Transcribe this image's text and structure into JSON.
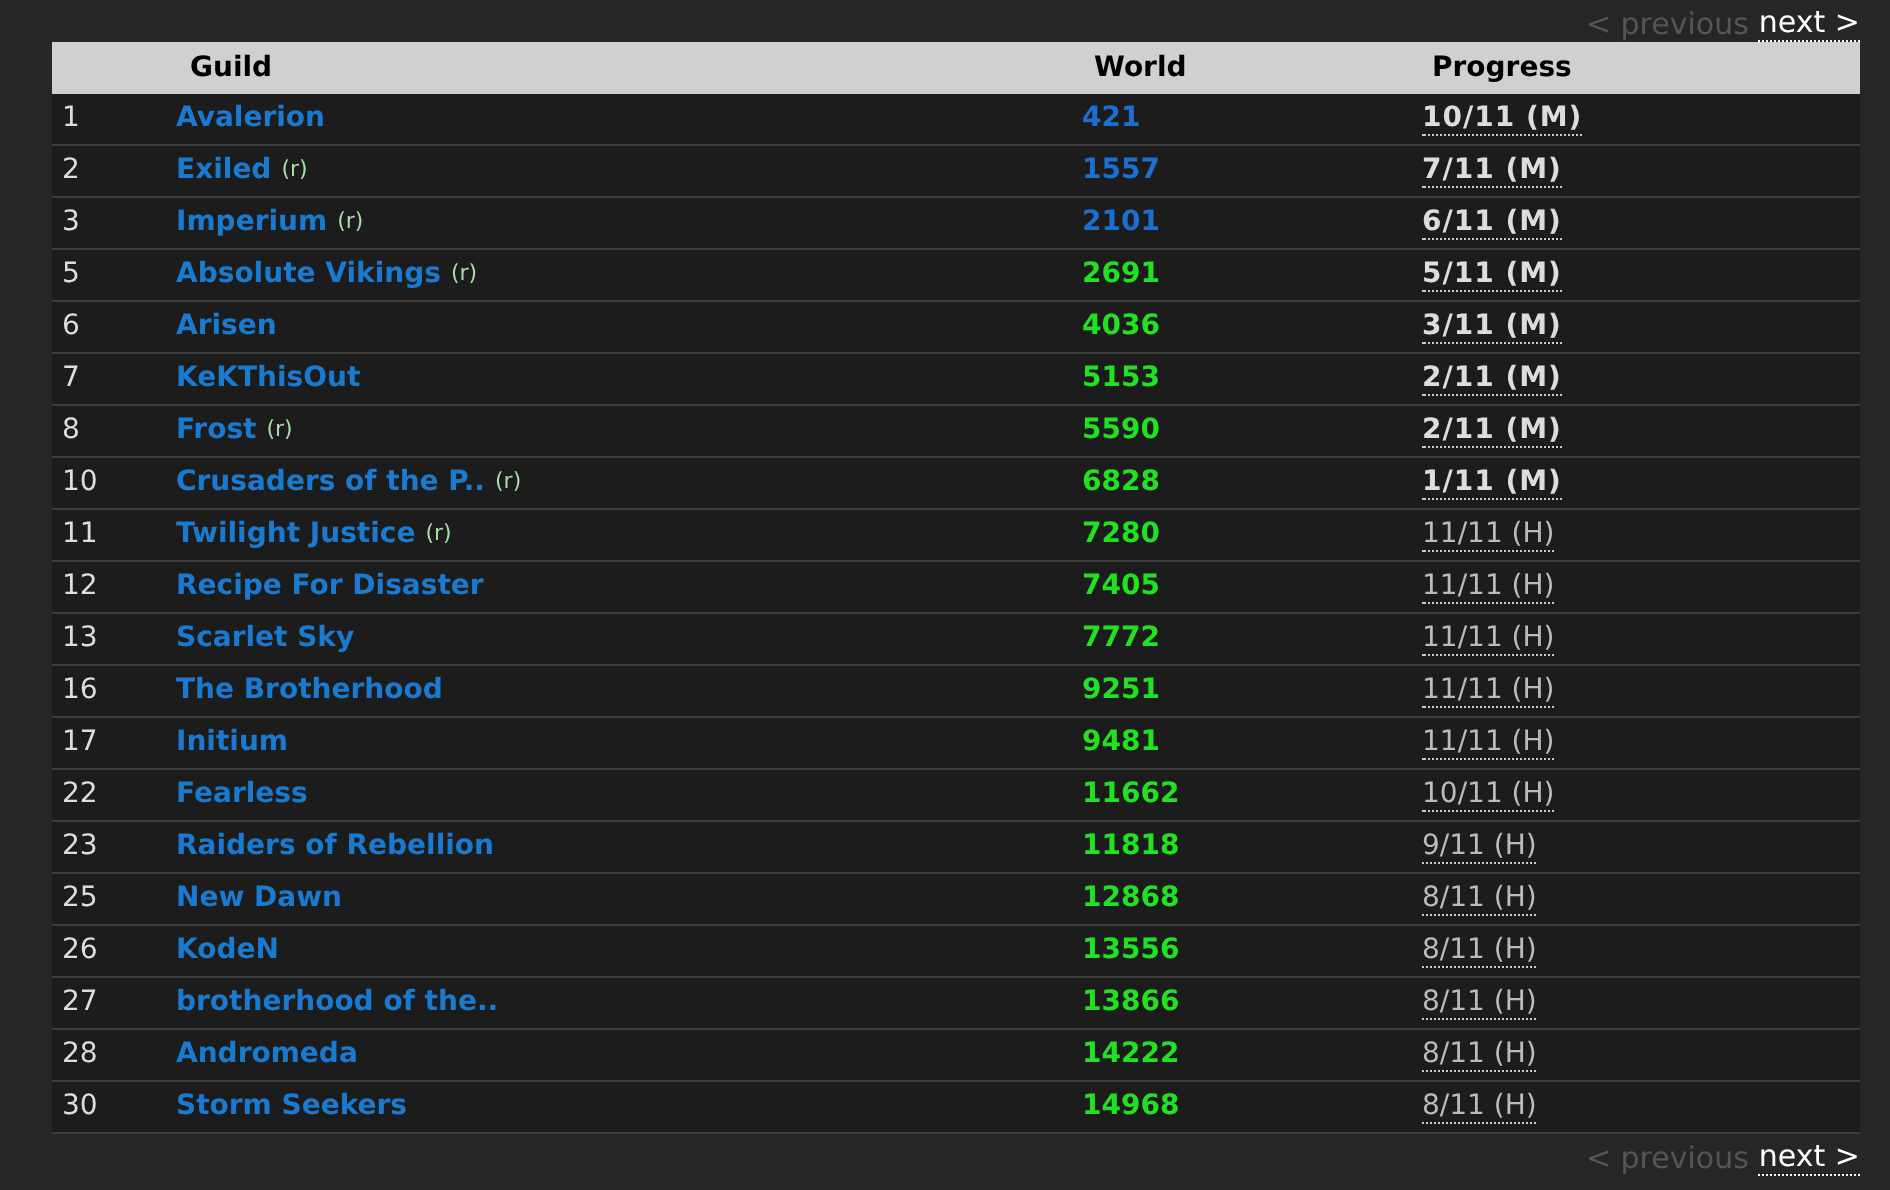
{
  "pager_top": {
    "previous": {
      "label": "< previous",
      "disabled": true
    },
    "next": {
      "label": "next >",
      "disabled": false
    }
  },
  "table": {
    "columns": [
      "Guild",
      "World",
      "Progress"
    ],
    "rows": [
      {
        "rank": "1",
        "guild": {
          "name": "Avalerion"
        },
        "world": "421",
        "color": "#1a6fd0",
        "progress": "10/11 (M)",
        "kind": "mythic"
      },
      {
        "rank": "2",
        "guild": {
          "name": "Exiled",
          "tag": "(r)"
        },
        "world": "1557",
        "color": "#1a6fd0",
        "progress": "7/11 (M)",
        "kind": "mythic"
      },
      {
        "rank": "3",
        "guild": {
          "name": "Imperium",
          "tag": "(r)"
        },
        "world": "2101",
        "color": "#1a6fd0",
        "progress": "6/11 (M)",
        "kind": "mythic"
      },
      {
        "rank": "5",
        "guild": {
          "name": "Absolute Vikings",
          "tag": "(r)"
        },
        "world": "2691",
        "color": "#22e022",
        "progress": "5/11 (M)",
        "kind": "mythic"
      },
      {
        "rank": "6",
        "guild": {
          "name": "Arisen"
        },
        "world": "4036",
        "color": "#22e022",
        "progress": "3/11 (M)",
        "kind": "mythic"
      },
      {
        "rank": "7",
        "guild": {
          "name": "KeKThisOut"
        },
        "world": "5153",
        "color": "#22e022",
        "progress": "2/11 (M)",
        "kind": "mythic"
      },
      {
        "rank": "8",
        "guild": {
          "name": "Frost",
          "tag": "(r)"
        },
        "world": "5590",
        "color": "#22e022",
        "progress": "2/11 (M)",
        "kind": "mythic"
      },
      {
        "rank": "10",
        "guild": {
          "name": "Crusaders of the P..",
          "tag": "(r)"
        },
        "world": "6828",
        "color": "#22e022",
        "progress": "1/11 (M)",
        "kind": "mythic"
      },
      {
        "rank": "11",
        "guild": {
          "name": "Twilight Justice",
          "tag": "(r)"
        },
        "world": "7280",
        "color": "#22e022",
        "progress": "11/11 (H)",
        "kind": "heroic"
      },
      {
        "rank": "12",
        "guild": {
          "name": "Recipe For Disaster"
        },
        "world": "7405",
        "color": "#22e022",
        "progress": "11/11 (H)",
        "kind": "heroic"
      },
      {
        "rank": "13",
        "guild": {
          "name": "Scarlet Sky"
        },
        "world": "7772",
        "color": "#22e022",
        "progress": "11/11 (H)",
        "kind": "heroic"
      },
      {
        "rank": "16",
        "guild": {
          "name": "The Brotherhood"
        },
        "world": "9251",
        "color": "#22e022",
        "progress": "11/11 (H)",
        "kind": "heroic"
      },
      {
        "rank": "17",
        "guild": {
          "name": "Initium"
        },
        "world": "9481",
        "color": "#22e022",
        "progress": "11/11 (H)",
        "kind": "heroic"
      },
      {
        "rank": "22",
        "guild": {
          "name": "Fearless"
        },
        "world": "11662",
        "color": "#22e022",
        "progress": "10/11 (H)",
        "kind": "heroic"
      },
      {
        "rank": "23",
        "guild": {
          "name": "Raiders of Rebellion"
        },
        "world": "11818",
        "color": "#22e022",
        "progress": "9/11 (H)",
        "kind": "heroic"
      },
      {
        "rank": "25",
        "guild": {
          "name": "New Dawn"
        },
        "world": "12868",
        "color": "#22e022",
        "progress": "8/11 (H)",
        "kind": "heroic"
      },
      {
        "rank": "26",
        "guild": {
          "name": "KodeN"
        },
        "world": "13556",
        "color": "#22e022",
        "progress": "8/11 (H)",
        "kind": "heroic"
      },
      {
        "rank": "27",
        "guild": {
          "name": "brotherhood of the.."
        },
        "world": "13866",
        "color": "#22e022",
        "progress": "8/11 (H)",
        "kind": "heroic"
      },
      {
        "rank": "28",
        "guild": {
          "name": "Andromeda"
        },
        "world": "14222",
        "color": "#22e022",
        "progress": "8/11 (H)",
        "kind": "heroic"
      },
      {
        "rank": "30",
        "guild": {
          "name": "Storm Seekers"
        },
        "world": "14968",
        "color": "#22e022",
        "progress": "8/11 (H)",
        "kind": "heroic"
      }
    ]
  },
  "pager_bottom": {
    "previous": {
      "label": "< previous",
      "disabled": true
    },
    "next": {
      "label": "next >",
      "disabled": false
    }
  }
}
